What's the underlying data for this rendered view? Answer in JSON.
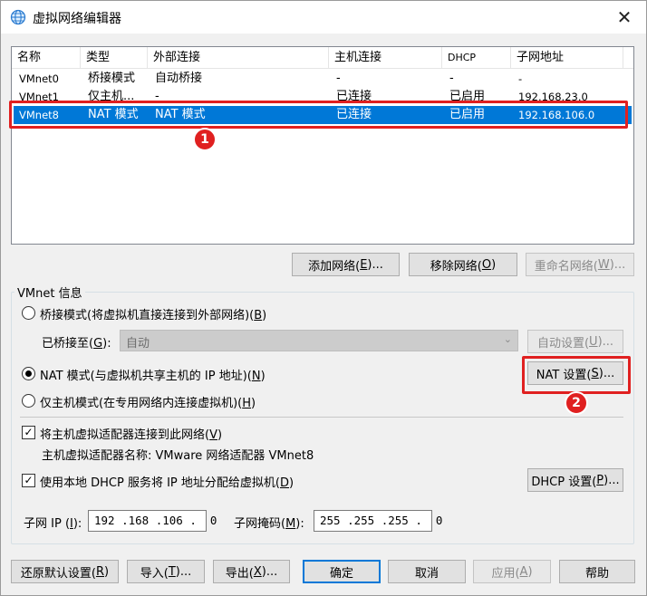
{
  "window": {
    "title": "虚拟网络编辑器",
    "close_glyph": "✕"
  },
  "list": {
    "headers": [
      "名称",
      "类型",
      "外部连接",
      "主机连接",
      "DHCP",
      "子网地址"
    ],
    "rows": [
      [
        "VMnet0",
        "桥接模式",
        "自动桥接",
        "-",
        "-",
        "-"
      ],
      [
        "VMnet1",
        "仅主机...",
        "-",
        "已连接",
        "已启用",
        "192.168.23.0"
      ],
      [
        "VMnet8",
        "NAT 模式",
        "NAT 模式",
        "已连接",
        "已启用",
        "192.168.106.0"
      ]
    ],
    "selected_index": 2
  },
  "annotations": {
    "badge1": "1",
    "badge2": "2"
  },
  "list_buttons": {
    "add": "添加网络(E)...",
    "remove": "移除网络(O)",
    "rename": "重命名网络(W)..."
  },
  "vmnet_info": {
    "group_title": "VMnet 信息",
    "bridge_mode": "桥接模式(将虚拟机直接连接到外部网络)(B)",
    "bridged_to_label": "已桥接至(G):",
    "bridged_to_value": "自动",
    "auto_settings": "自动设置(U)...",
    "nat_mode": "NAT 模式(与虚拟机共享主机的 IP 地址)(N)",
    "nat_settings": "NAT 设置(S)...",
    "host_only": "仅主机模式(在专用网络内连接虚拟机)(H)",
    "connect_adapter": "将主机虚拟适配器连接到此网络(V)",
    "adapter_name": "主机虚拟适配器名称: VMware 网络适配器 VMnet8",
    "use_dhcp": "使用本地 DHCP 服务将 IP 地址分配给虚拟机(D)",
    "dhcp_settings": "DHCP 设置(P)...",
    "subnet_ip_label": "子网 IP (I):",
    "subnet_ip_value": "192 .168 .106 .  0",
    "subnet_mask_label": "子网掩码(M):",
    "subnet_mask_value": "255 .255 .255 .  0",
    "selected_mode": "nat",
    "connect_adapter_checked": true,
    "use_dhcp_checked": true
  },
  "footer": {
    "restore": "还原默认设置(R)",
    "import": "导入(T)...",
    "export": "导出(X)...",
    "ok": "确定",
    "cancel": "取消",
    "apply": "应用(A)",
    "help": "帮助"
  },
  "colors": {
    "selection": "#0078d7",
    "annotation": "#e02020"
  }
}
